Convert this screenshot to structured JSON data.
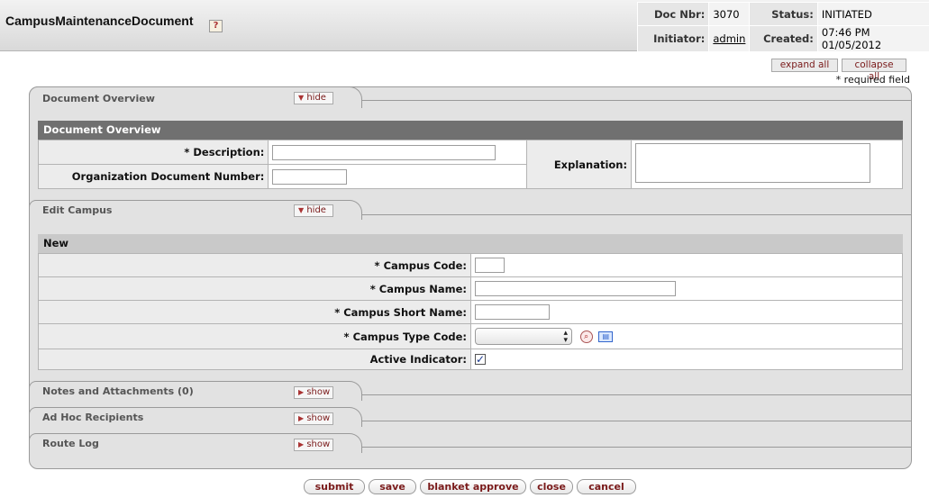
{
  "header": {
    "title": "CampusMaintenanceDocument",
    "help_icon": "?",
    "doc_nbr_label": "Doc Nbr:",
    "doc_nbr": "3070",
    "status_label": "Status:",
    "status": "INITIATED",
    "initiator_label": "Initiator:",
    "initiator": "admin",
    "created_label": "Created:",
    "created": "07:46 PM 01/05/2012"
  },
  "controls": {
    "expand_all": "expand all",
    "collapse_all": "collapse all",
    "required_note": "* required field"
  },
  "document_overview": {
    "tab_label": "Document Overview",
    "toggle": "hide",
    "section_title": "Document Overview",
    "description_label": "* Description:",
    "description_value": "",
    "org_doc_number_label": "Organization Document Number:",
    "org_doc_number_value": "",
    "explanation_label": "Explanation:",
    "explanation_value": ""
  },
  "edit_campus": {
    "tab_label": "Edit Campus",
    "toggle": "hide",
    "section_title": "New",
    "campus_code_label": "* Campus Code:",
    "campus_code_value": "",
    "campus_name_label": "* Campus Name:",
    "campus_name_value": "",
    "campus_short_name_label": "* Campus Short Name:",
    "campus_short_name_value": "",
    "campus_type_code_label": "* Campus Type Code:",
    "campus_type_code_value": "",
    "active_indicator_label": "Active Indicator:",
    "active_indicator_checked": true
  },
  "collapsed_tabs": [
    {
      "label": "Notes and Attachments (0)",
      "toggle": "show"
    },
    {
      "label": "Ad Hoc Recipients",
      "toggle": "show"
    },
    {
      "label": "Route Log",
      "toggle": "show"
    }
  ],
  "actions": {
    "submit": "submit",
    "save": "save",
    "blanket_approve": "blanket approve",
    "close": "close",
    "cancel": "cancel"
  },
  "icons": {
    "toggle_hide": "triangle-down",
    "toggle_show": "triangle-right",
    "lookup": "magnifier",
    "direct_inquiry": "book",
    "select_arrows": "up-down-chevrons"
  },
  "colors": {
    "header_bg": "#dedede",
    "section_head": "#707070",
    "button_text": "#7a1a1a",
    "panel_bg": "#e2e2e2"
  }
}
